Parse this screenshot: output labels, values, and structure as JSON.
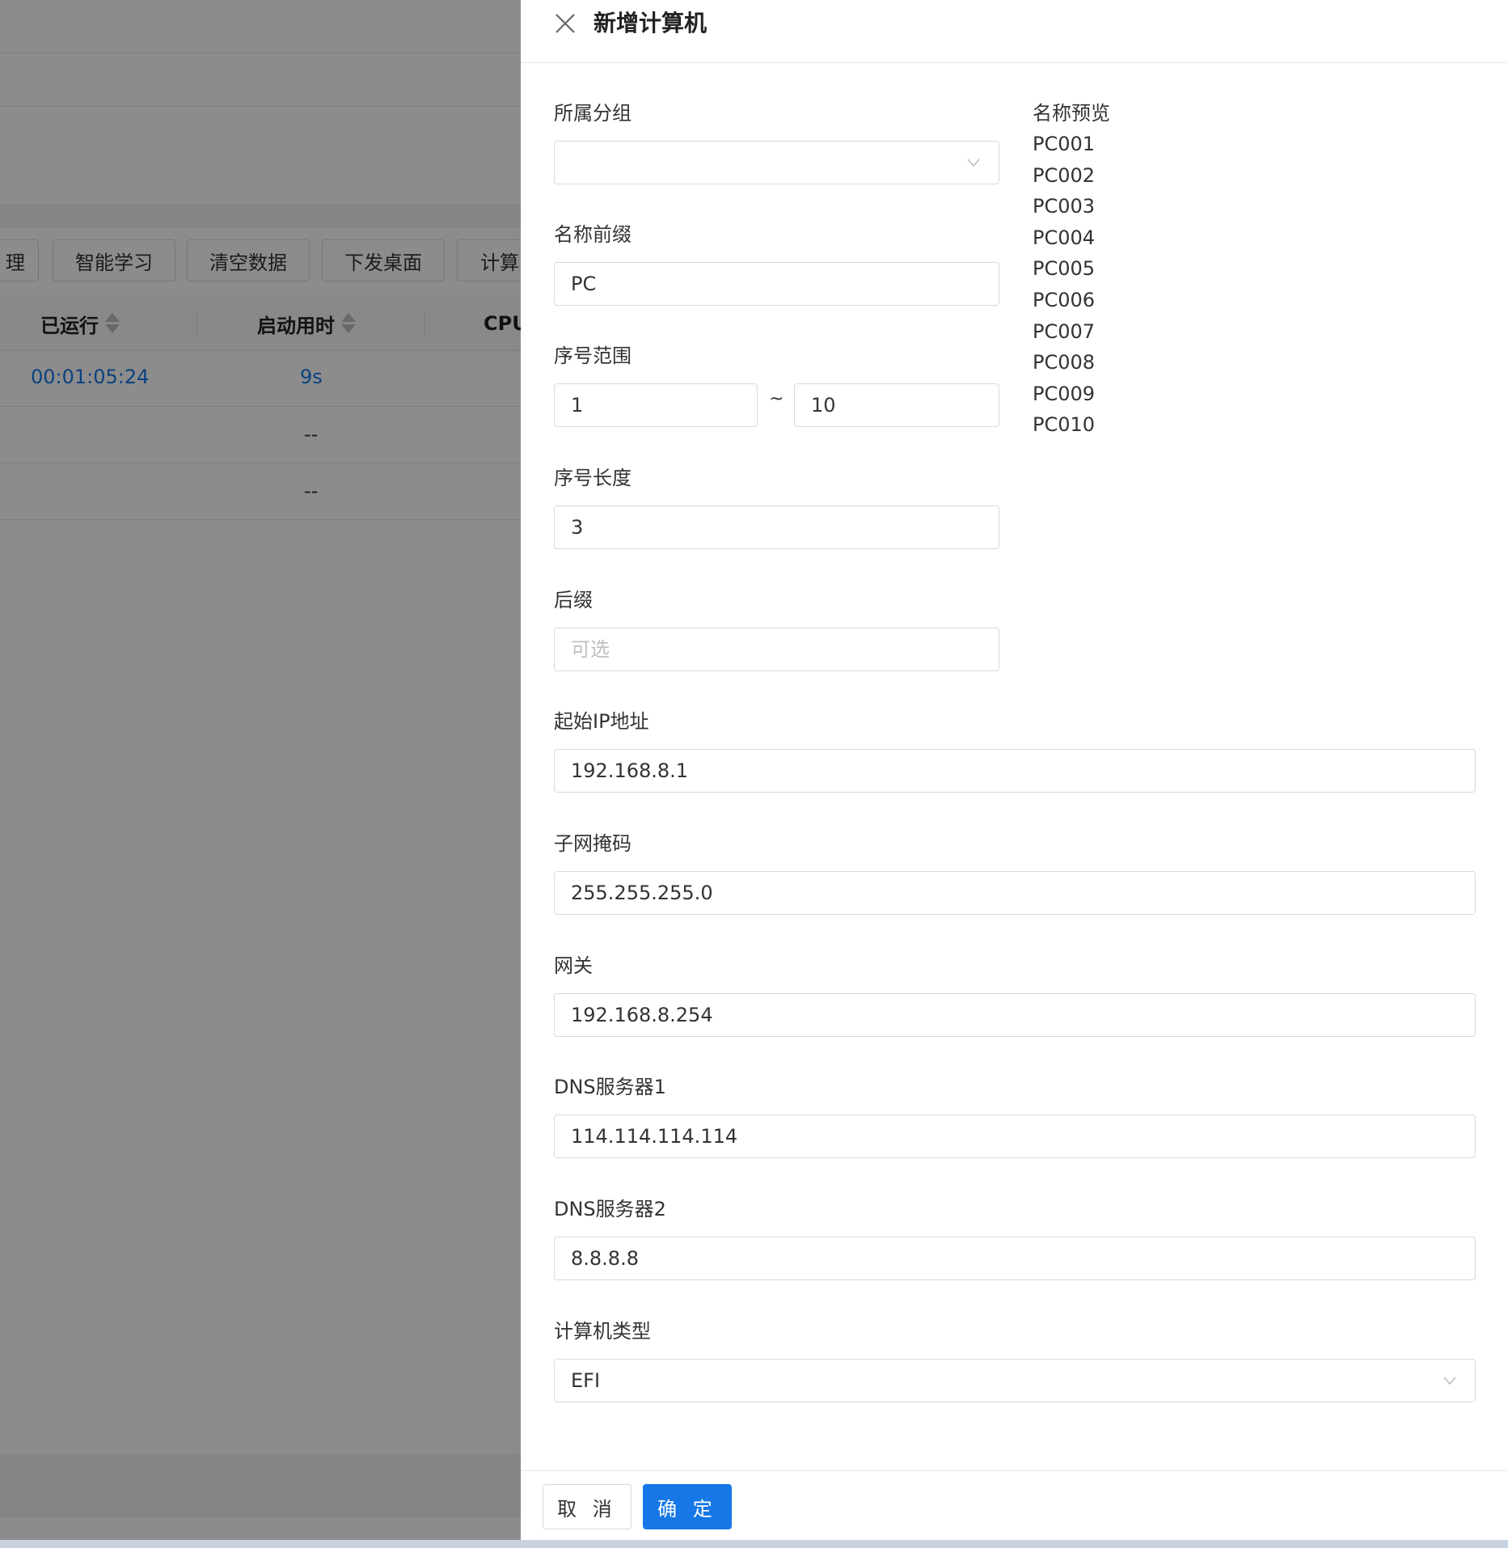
{
  "background": {
    "toolbar_buttons": [
      "理",
      "智能学习",
      "清空数据",
      "下发桌面",
      "计算"
    ],
    "table_headers": [
      "已运行",
      "启动用时",
      "CPU"
    ],
    "rows": [
      {
        "uptime": "00:01:05:24",
        "boot_time": "9s"
      },
      {
        "uptime": "",
        "boot_time": "--"
      },
      {
        "uptime": "",
        "boot_time": "--"
      }
    ]
  },
  "drawer": {
    "title": "新增计算机",
    "fields": {
      "group": {
        "label": "所属分组",
        "value": ""
      },
      "prefix": {
        "label": "名称前缀",
        "value": "PC"
      },
      "range": {
        "label": "序号范围",
        "from": "1",
        "separator": "~",
        "to": "10"
      },
      "length": {
        "label": "序号长度",
        "value": "3"
      },
      "suffix": {
        "label": "后缀",
        "placeholder": "可选"
      },
      "start_ip": {
        "label": "起始IP地址",
        "value": "192.168.8.1"
      },
      "subnet": {
        "label": "子网掩码",
        "value": "255.255.255.0"
      },
      "gateway": {
        "label": "网关",
        "value": "192.168.8.254"
      },
      "dns1": {
        "label": "DNS服务器1",
        "value": "114.114.114.114"
      },
      "dns2": {
        "label": "DNS服务器2",
        "value": "8.8.8.8"
      },
      "type": {
        "label": "计算机类型",
        "value": "EFI"
      }
    },
    "preview": {
      "title": "名称预览",
      "names": [
        "PC001",
        "PC002",
        "PC003",
        "PC004",
        "PC005",
        "PC006",
        "PC007",
        "PC008",
        "PC009",
        "PC010"
      ]
    },
    "footer": {
      "cancel": "取 消",
      "ok": "确 定"
    }
  },
  "colors": {
    "primary": "#1677e6",
    "link": "#1677e6",
    "mask": "rgba(0,0,0,0.45)"
  }
}
